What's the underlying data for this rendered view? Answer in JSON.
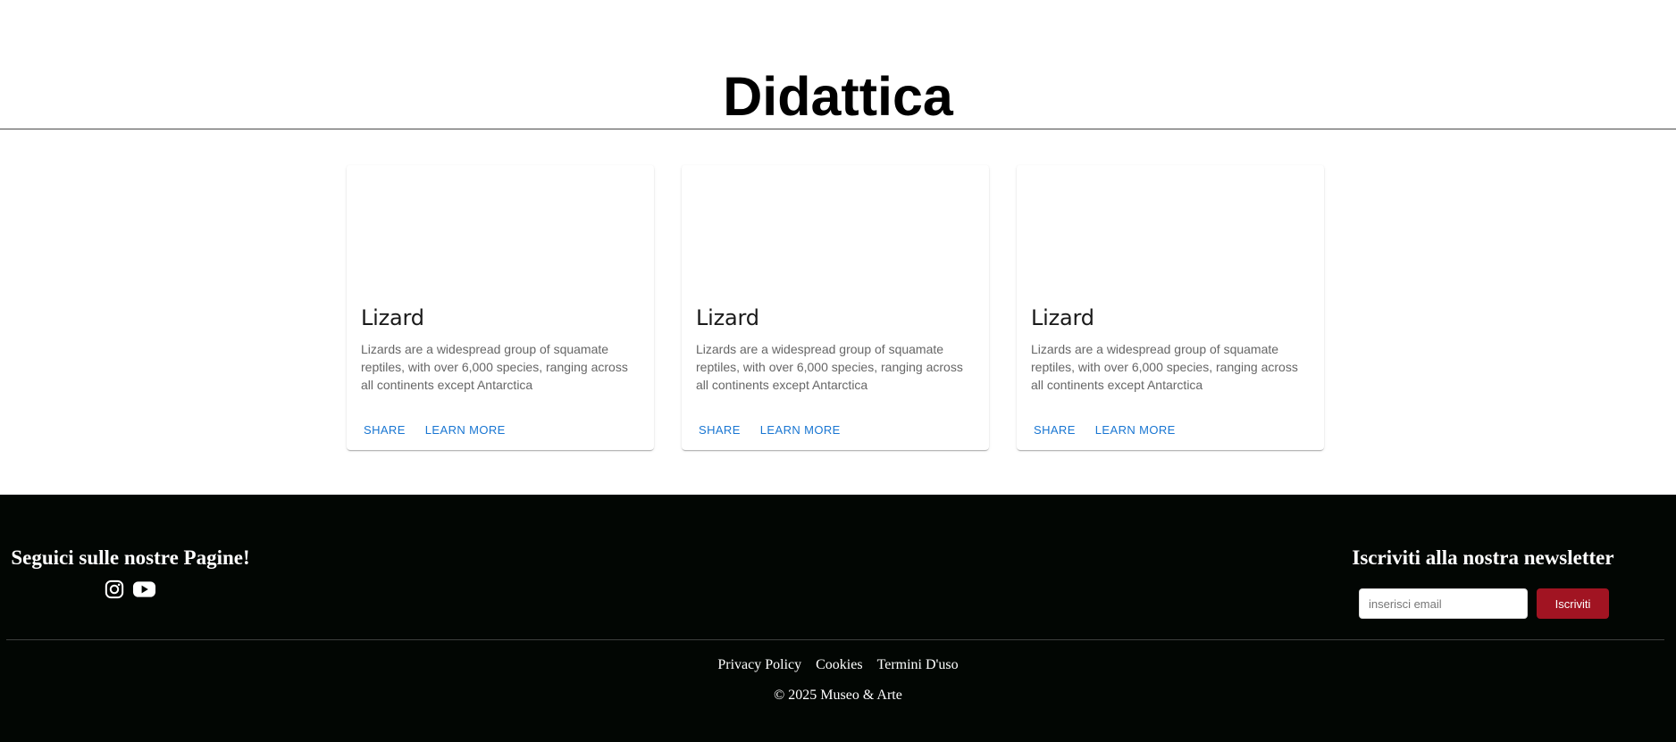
{
  "header": {
    "title": "Didattica"
  },
  "cards": [
    {
      "title": "Lizard",
      "text": "Lizards are a widespread group of squamate reptiles, with over 6,000 species, ranging across all continents except Antarctica",
      "share_label": "Share",
      "learn_more_label": "Learn More"
    },
    {
      "title": "Lizard",
      "text": "Lizards are a widespread group of squamate reptiles, with over 6,000 species, ranging across all continents except Antarctica",
      "share_label": "Share",
      "learn_more_label": "Learn More"
    },
    {
      "title": "Lizard",
      "text": "Lizards are a widespread group of squamate reptiles, with over 6,000 species, ranging across all continents except Antarctica",
      "share_label": "Share",
      "learn_more_label": "Learn More"
    }
  ],
  "footer": {
    "follow_heading": "Seguici sulle nostre Pagine!",
    "social_icons": [
      "instagram-icon",
      "youtube-icon"
    ],
    "newsletter_heading": "Iscriviti alla nostra newsletter",
    "email_placeholder": "inserisci email",
    "email_value": "",
    "subscribe_label": "Iscriviti",
    "links": [
      "Privacy Policy",
      "Cookies",
      "Termini D'uso"
    ],
    "copyright": "© 2025 Museo & Arte"
  },
  "colors": {
    "background": "#ffffff",
    "footer_background": "#020603",
    "button_text": "#1976d2",
    "subscribe_button": "#a11422"
  }
}
